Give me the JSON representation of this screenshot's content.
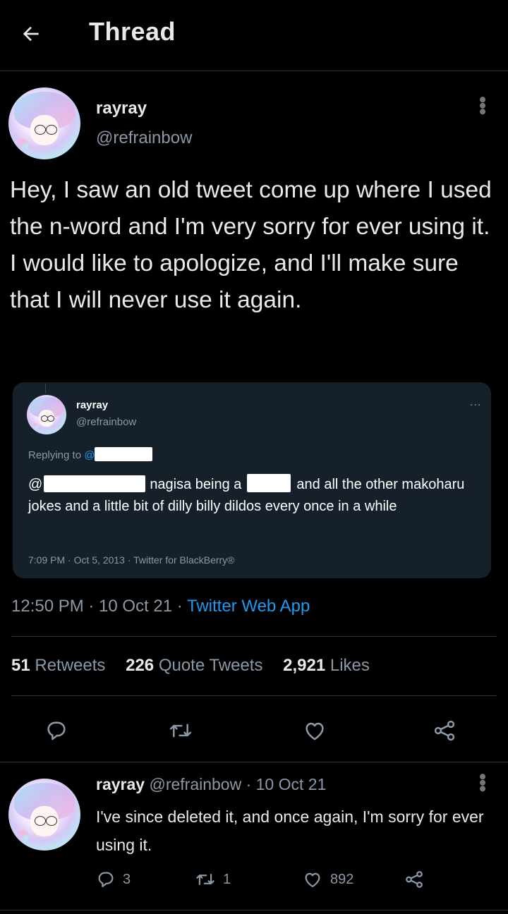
{
  "header": {
    "title": "Thread",
    "back_icon": "arrow-left-icon"
  },
  "main_tweet": {
    "name": "rayray",
    "handle": "@refrainbow",
    "text": "Hey, I saw an old tweet come up where I used the n-word and I'm very sorry for ever using it. I would like to apologize, and I'll make sure that I will never use it again.",
    "embedded": {
      "name": "rayray",
      "handle": "@refrainbow",
      "more": "...",
      "replying_to_label": "Replying to ",
      "replying_to_mention": "@",
      "text_start": "@",
      "text_mid": "nagisa being a",
      "text_end": "and all the other makoharu jokes and a little bit of dilly billy dildos every once in a while",
      "meta": "7:09 PM · Oct 5, 2013 · Twitter for BlackBerry®"
    },
    "timestamp": "12:50 PM · 10 Oct 21 · ",
    "source": "Twitter Web App",
    "stats": {
      "retweets_num": "51",
      "retweets_label": "Retweets",
      "quotes_num": "226",
      "quotes_label": "Quote Tweets",
      "likes_num": "2,921",
      "likes_label": "Likes"
    },
    "actions": [
      "reply-icon",
      "retweet-icon",
      "like-icon",
      "share-icon"
    ]
  },
  "reply_tweet": {
    "name": "rayray",
    "handle_date": "@refrainbow · 10 Oct 21",
    "text": "I've since deleted it, and once again, I'm sorry for ever using it.",
    "reply_count": "3",
    "retweet_count": "1",
    "like_count": "892"
  },
  "colors": {
    "background": "#000000",
    "accent": "#1d9bf0",
    "secondary_text": "#8b98a5",
    "embed_bg": "#15202b"
  }
}
